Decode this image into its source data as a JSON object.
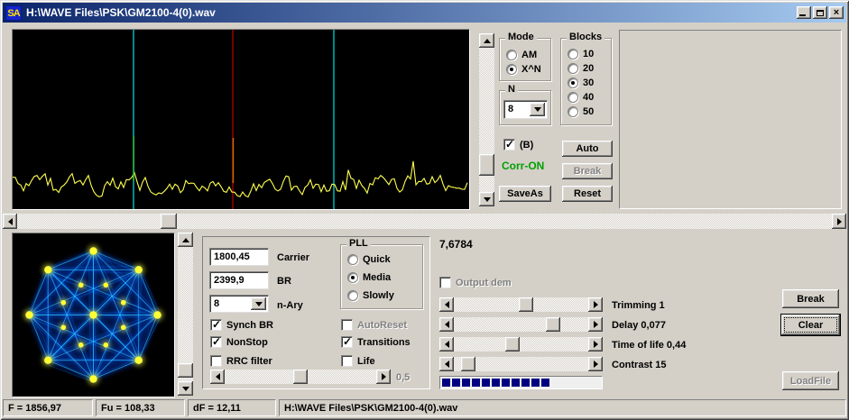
{
  "window": {
    "icon_text": "SA",
    "title": "H:\\WAVE Files\\PSK\\GM2100-4(0).wav"
  },
  "top_panel": {
    "mode_group": {
      "title": "Mode",
      "options": [
        {
          "label": "AM",
          "selected": false
        },
        {
          "label": "X^N",
          "selected": true
        }
      ]
    },
    "blocks_group": {
      "title": "Blocks",
      "options": [
        {
          "label": "10",
          "selected": false
        },
        {
          "label": "20",
          "selected": false
        },
        {
          "label": "30",
          "selected": true
        },
        {
          "label": "40",
          "selected": false
        },
        {
          "label": "50",
          "selected": false
        }
      ]
    },
    "n_group": {
      "title": "N",
      "value": "8"
    },
    "b_checkbox": {
      "label": "(B)",
      "checked": true
    },
    "corr_status": {
      "text": "Corr-ON",
      "color": "#00a000"
    },
    "auto_button": "Auto",
    "break_button": "Break",
    "saveas_button": "SaveAs",
    "reset_button": "Reset"
  },
  "spectrum": {
    "background": "#000000",
    "trace_color": "#ffff4d",
    "markers": [
      {
        "pos": 0.265,
        "color": "#00d2d2",
        "peak_top": 0.387
      },
      {
        "pos": 0.483,
        "color": "#b40000",
        "peak_top": 0.392
      },
      {
        "pos": 0.704,
        "color": "#00d2d2",
        "peak_top": 0.563
      }
    ]
  },
  "constellation": {
    "background": "#000000",
    "points": 8,
    "dot_color": "#ffff33",
    "line_color": "#0077ff"
  },
  "control_panel": {
    "carrier": {
      "value": "1800,45",
      "label": "Carrier"
    },
    "br": {
      "value": "2399,9",
      "label": "BR"
    },
    "nary": {
      "value": "8",
      "label": "n-Ary"
    },
    "synch_br": {
      "label": "Synch BR",
      "checked": true
    },
    "nonstop": {
      "label": "NonStop",
      "checked": true
    },
    "rrc": {
      "label": "RRC filter",
      "checked": false
    },
    "pll_group": {
      "title": "PLL",
      "options": [
        {
          "label": "Quick",
          "selected": false
        },
        {
          "label": "Media",
          "selected": true
        },
        {
          "label": "Slowly",
          "selected": false
        }
      ]
    },
    "autoreset": {
      "label": "AutoReset",
      "checked": false,
      "disabled": true
    },
    "transitions": {
      "label": "Transitions",
      "checked": true
    },
    "life": {
      "label": "Life",
      "checked": false
    },
    "shape_slider": {
      "fraction": 0.5,
      "value_label": "0,5"
    }
  },
  "right_panel": {
    "freq_value": "7,6784",
    "output_dem": {
      "label": "Output dem",
      "checked": false,
      "disabled": true
    },
    "sliders": [
      {
        "label": "Trimming 1",
        "fraction": 0.54
      },
      {
        "label": "Delay  0,077",
        "fraction": 0.77
      },
      {
        "label": "Time of life 0,44",
        "fraction": 0.43
      },
      {
        "label": "Contrast 15",
        "fraction": 0.06
      }
    ],
    "progress": {
      "filled_blocks": 11,
      "fill_fraction": 0.54,
      "fill_color": "#000080"
    },
    "break_button": "Break",
    "clear_button": "Clear",
    "loadfile_button": "LoadFile"
  },
  "scrollbars": {
    "top_vertical": {
      "thumb_fraction": 0.87
    },
    "main_horizontal": {
      "thumb_fraction": 0.18
    },
    "bottom_vertical": {
      "thumb_fraction": 0.97
    }
  },
  "statusbar": {
    "panels": [
      {
        "text": "F = 1856,97"
      },
      {
        "text": "Fu = 108,33"
      },
      {
        "text": "dF = 12,11"
      },
      {
        "text": "H:\\WAVE Files\\PSK\\GM2100-4(0).wav"
      }
    ]
  }
}
